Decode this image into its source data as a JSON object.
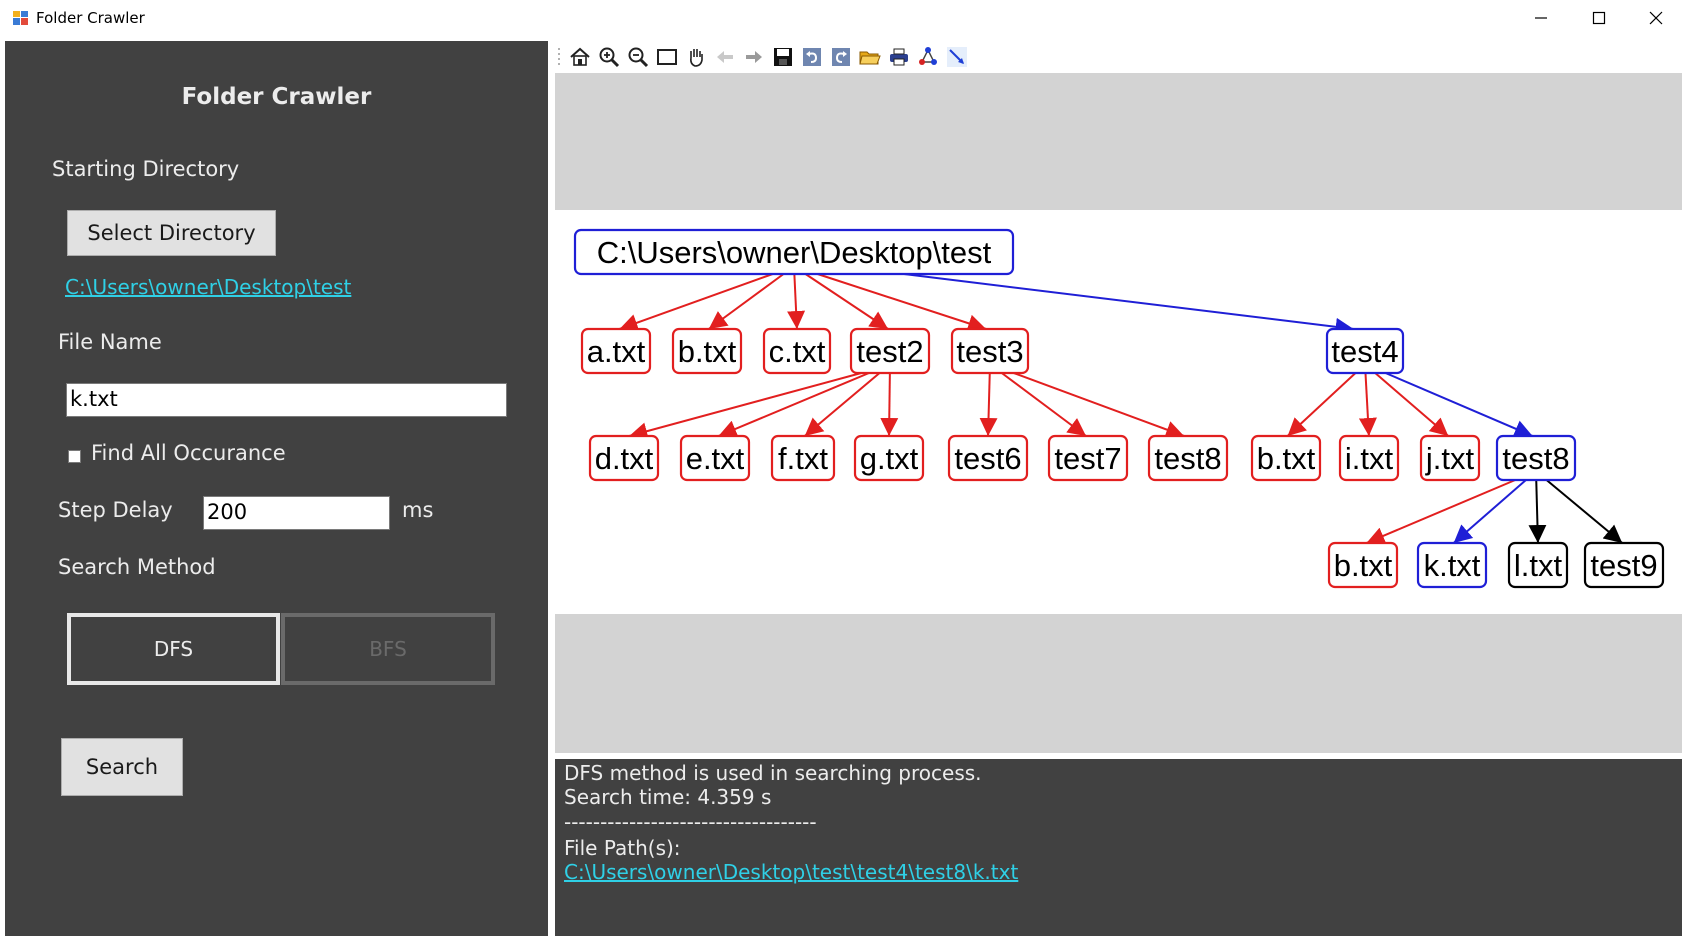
{
  "window": {
    "title": "Folder Crawler"
  },
  "sidebar": {
    "heading": "Folder Crawler",
    "starting_directory_label": "Starting Directory",
    "select_directory_button": "Select Directory",
    "selected_directory": "C:\\Users\\owner\\Desktop\\test",
    "file_name_label": "File Name",
    "file_name_value": "k.txt",
    "find_all_label": "Find All Occurance",
    "find_all_checked": false,
    "step_delay_label": "Step Delay",
    "step_delay_value": "200",
    "step_delay_unit": "ms",
    "search_method_label": "Search Method",
    "methods": [
      {
        "label": "DFS",
        "selected": true
      },
      {
        "label": "BFS",
        "selected": false
      }
    ],
    "search_button": "Search"
  },
  "toolbar": {
    "icons": [
      "home-icon",
      "zoom-in-icon",
      "zoom-out-icon",
      "window-zoom-icon",
      "pan-hand-icon",
      "back-arrow-icon",
      "forward-arrow-icon",
      "save-icon",
      "undo-icon",
      "redo-icon",
      "open-folder-icon",
      "print-icon",
      "layout-graph-icon",
      "insert-edge-icon"
    ]
  },
  "graph": {
    "colors": {
      "red": "#e21f1f",
      "blue": "#1f1fd6",
      "black": "#000000"
    },
    "nodes": [
      {
        "id": "root",
        "label": "C:\\Users\\owner\\Desktop\\test",
        "color": "blue"
      },
      {
        "id": "a",
        "label": "a.txt",
        "color": "red"
      },
      {
        "id": "b1",
        "label": "b.txt",
        "color": "red"
      },
      {
        "id": "c",
        "label": "c.txt",
        "color": "red"
      },
      {
        "id": "test2",
        "label": "test2",
        "color": "red"
      },
      {
        "id": "test3",
        "label": "test3",
        "color": "red"
      },
      {
        "id": "test4",
        "label": "test4",
        "color": "blue"
      },
      {
        "id": "d",
        "label": "d.txt",
        "color": "red"
      },
      {
        "id": "e",
        "label": "e.txt",
        "color": "red"
      },
      {
        "id": "f",
        "label": "f.txt",
        "color": "red"
      },
      {
        "id": "g",
        "label": "g.txt",
        "color": "red"
      },
      {
        "id": "test6",
        "label": "test6",
        "color": "red"
      },
      {
        "id": "test7",
        "label": "test7",
        "color": "red"
      },
      {
        "id": "test8a",
        "label": "test8",
        "color": "red"
      },
      {
        "id": "b2",
        "label": "b.txt",
        "color": "red"
      },
      {
        "id": "i",
        "label": "i.txt",
        "color": "red"
      },
      {
        "id": "j",
        "label": "j.txt",
        "color": "red"
      },
      {
        "id": "test8b",
        "label": "test8",
        "color": "blue"
      },
      {
        "id": "b3",
        "label": "b.txt",
        "color": "red"
      },
      {
        "id": "k",
        "label": "k.txt",
        "color": "blue"
      },
      {
        "id": "l",
        "label": "l.txt",
        "color": "black"
      },
      {
        "id": "test9",
        "label": "test9",
        "color": "black"
      }
    ],
    "edges": [
      {
        "from": "root",
        "to": "a",
        "color": "red"
      },
      {
        "from": "root",
        "to": "b1",
        "color": "red"
      },
      {
        "from": "root",
        "to": "c",
        "color": "red"
      },
      {
        "from": "root",
        "to": "test2",
        "color": "red"
      },
      {
        "from": "root",
        "to": "test3",
        "color": "red"
      },
      {
        "from": "root",
        "to": "test4",
        "color": "blue"
      },
      {
        "from": "test2",
        "to": "d",
        "color": "red"
      },
      {
        "from": "test2",
        "to": "e",
        "color": "red"
      },
      {
        "from": "test2",
        "to": "f",
        "color": "red"
      },
      {
        "from": "test2",
        "to": "g",
        "color": "red"
      },
      {
        "from": "test3",
        "to": "test6",
        "color": "red"
      },
      {
        "from": "test3",
        "to": "test7",
        "color": "red"
      },
      {
        "from": "test3",
        "to": "test8a",
        "color": "red"
      },
      {
        "from": "test4",
        "to": "b2",
        "color": "red"
      },
      {
        "from": "test4",
        "to": "i",
        "color": "red"
      },
      {
        "from": "test4",
        "to": "j",
        "color": "red"
      },
      {
        "from": "test4",
        "to": "test8b",
        "color": "blue"
      },
      {
        "from": "test8b",
        "to": "b3",
        "color": "red"
      },
      {
        "from": "test8b",
        "to": "k",
        "color": "blue"
      },
      {
        "from": "test8b",
        "to": "l",
        "color": "black"
      },
      {
        "from": "test8b",
        "to": "test9",
        "color": "black"
      }
    ]
  },
  "output": {
    "line1": "DFS method is used in searching process.",
    "line2": "Search time: 4.359 s",
    "separator": "-----------------------------------",
    "paths_label": "File Path(s):",
    "path": "C:\\Users\\owner\\Desktop\\test\\test4\\test8\\k.txt"
  }
}
